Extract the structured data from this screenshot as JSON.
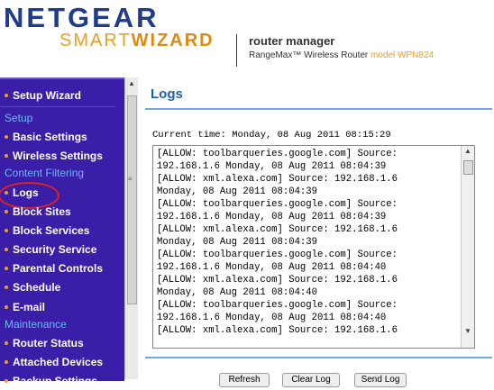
{
  "header": {
    "logo_text": "NETGEAR",
    "smart": "SMART",
    "wizard": "WIZARD",
    "title": "router manager",
    "subtitle": "RangeMax™ Wireless Router",
    "model": "model WPN824"
  },
  "sidebar": {
    "items": [
      {
        "label": "Setup Wizard"
      },
      {
        "label": "Basic Settings"
      },
      {
        "label": "Wireless Settings"
      },
      {
        "label": "Logs"
      },
      {
        "label": "Block Sites"
      },
      {
        "label": "Block Services"
      },
      {
        "label": "Security Service"
      },
      {
        "label": "Parental Controls"
      },
      {
        "label": "Schedule"
      },
      {
        "label": "E-mail"
      },
      {
        "label": "Router Status"
      },
      {
        "label": "Attached Devices"
      },
      {
        "label": "Backup Settings"
      }
    ],
    "sections": [
      "Setup",
      "Content Filtering",
      "Maintenance"
    ]
  },
  "main": {
    "title": "Logs",
    "current_time": "Current time: Monday, 08 Aug 2011 08:15:29",
    "log_lines": [
      "[ALLOW: toolbarqueries.google.com] Source:",
      "192.168.1.6 Monday, 08 Aug 2011 08:04:39",
      "[ALLOW: xml.alexa.com] Source: 192.168.1.6",
      "Monday, 08 Aug 2011 08:04:39",
      "[ALLOW: toolbarqueries.google.com] Source:",
      "192.168.1.6 Monday, 08 Aug 2011 08:04:39",
      "[ALLOW: xml.alexa.com] Source: 192.168.1.6",
      "Monday, 08 Aug 2011 08:04:39",
      "[ALLOW: toolbarqueries.google.com] Source:",
      "192.168.1.6 Monday, 08 Aug 2011 08:04:40",
      "[ALLOW: xml.alexa.com] Source: 192.168.1.6",
      "Monday, 08 Aug 2011 08:04:40",
      "[ALLOW: toolbarqueries.google.com] Source:",
      "192.168.1.6 Monday, 08 Aug 2011 08:04:40",
      "[ALLOW: xml.alexa.com] Source: 192.168.1.6"
    ],
    "buttons": [
      "Refresh",
      "Clear Log",
      "Send Log"
    ]
  },
  "colors": {
    "sidebar_bg": "#3a1ea8",
    "section_heading": "#6fb6ff",
    "bullet": "#e8a020",
    "title_blue": "#1f5fb0",
    "highlight_circle": "#dd2222"
  }
}
